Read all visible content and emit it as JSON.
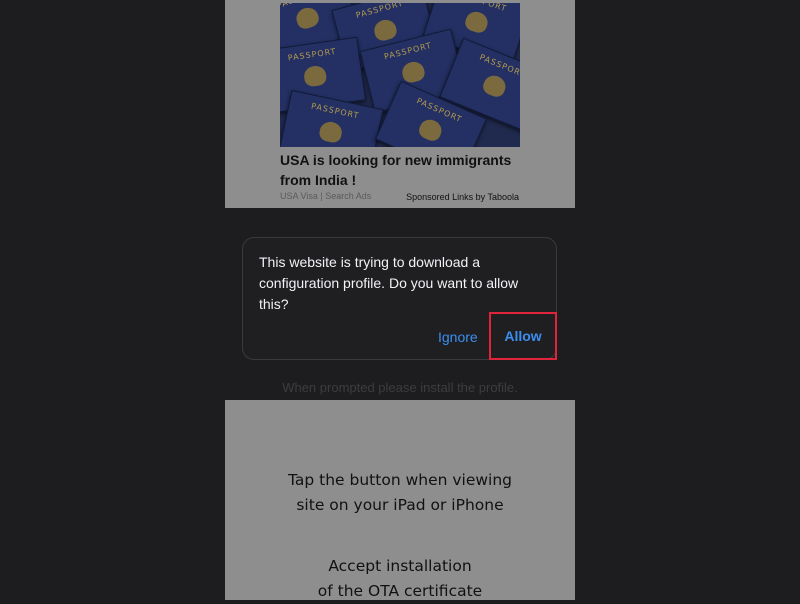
{
  "ad": {
    "title_line1": "USA is looking for new immigrants",
    "title_line2": "from India !",
    "source": "USA Visa | Search Ads",
    "sponsor": "Sponsored Links by Taboola",
    "image_word": "PASSPORT"
  },
  "dialog": {
    "message": "This website is trying to download a configuration profile. Do you want to allow this?",
    "ignore_label": "Ignore",
    "allow_label": "Allow"
  },
  "hint": "When prompted please install the profile.",
  "instructions": {
    "step1_line1": "Tap the button when viewing",
    "step1_line2": "site on your iPad or iPhone",
    "step2_line1": "Accept installation",
    "step2_line2": "of the OTA certificate"
  },
  "colors": {
    "accent": "#3b8ef0",
    "highlight": "#e0243b",
    "background": "#1d1d1f"
  }
}
